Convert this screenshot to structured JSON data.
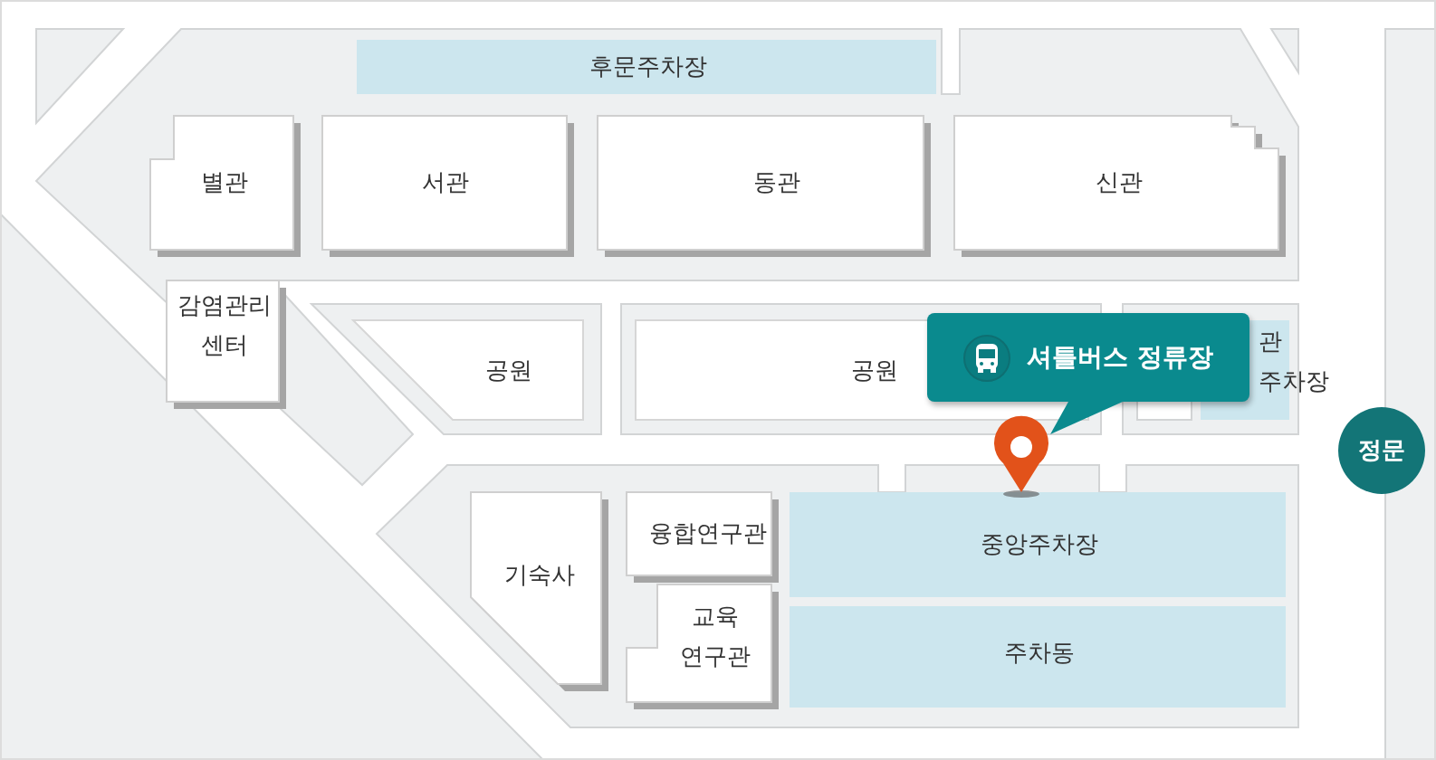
{
  "map": {
    "places": [
      {
        "label": "후문주차장",
        "kind": "parking"
      },
      {
        "label": "별관",
        "kind": "building"
      },
      {
        "label": "서관",
        "kind": "building"
      },
      {
        "label": "동관",
        "kind": "building"
      },
      {
        "label": "신관",
        "kind": "building"
      },
      {
        "label": "감염관리\n센터",
        "kind": "building"
      },
      {
        "label": "공원",
        "kind": "park"
      },
      {
        "label": "공원",
        "kind": "park"
      },
      {
        "label": "관\n주차장",
        "kind": "parking"
      },
      {
        "label": "기숙사",
        "kind": "building"
      },
      {
        "label": "융합연구관",
        "kind": "building"
      },
      {
        "label": "교육\n연구관",
        "kind": "building"
      },
      {
        "label": "중앙주차장",
        "kind": "parking"
      },
      {
        "label": "주차동",
        "kind": "parking"
      }
    ],
    "shuttle_stop": {
      "label": "셔틀버스 정류장"
    },
    "gate": {
      "label": "정문"
    }
  }
}
